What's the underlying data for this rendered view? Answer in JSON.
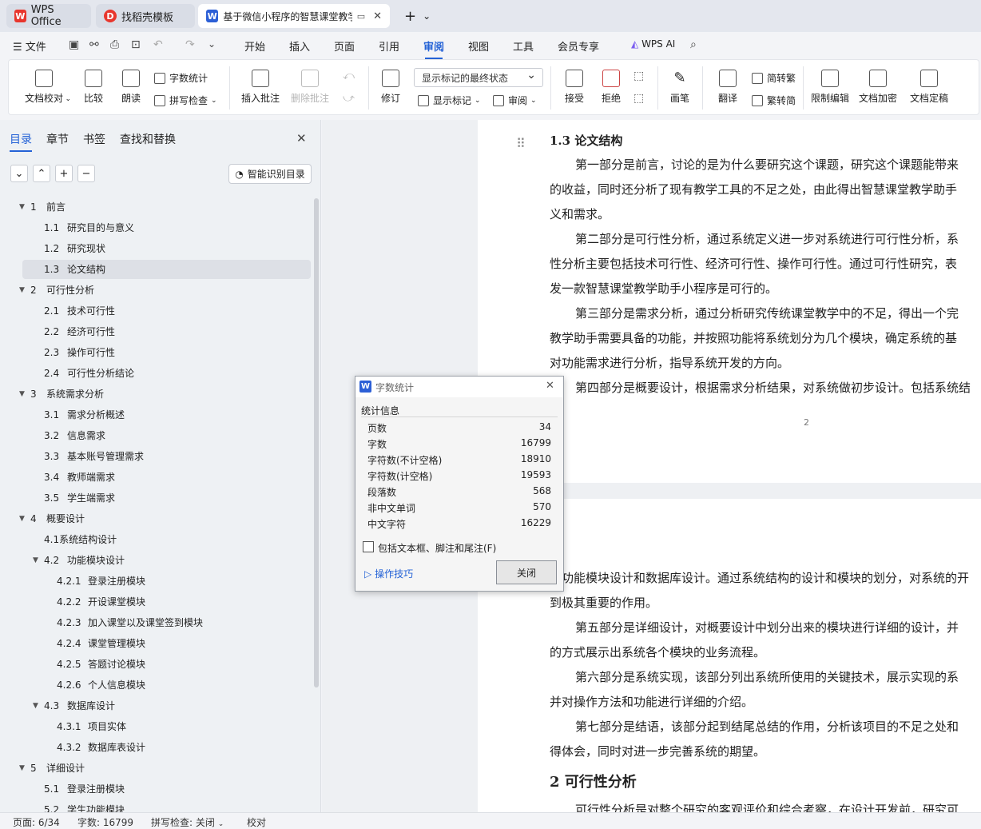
{
  "tabs": [
    {
      "label": "WPS Office",
      "icon": "wps-logo-icon"
    },
    {
      "label": "找稻壳模板",
      "icon": "daoke-logo-icon"
    },
    {
      "label": "基于微信小程序的智慧课堂教学",
      "icon": "word-doc-icon"
    }
  ],
  "menu": {
    "file": "文件",
    "items": [
      "开始",
      "插入",
      "页面",
      "引用",
      "审阅",
      "视图",
      "工具",
      "会员专享"
    ],
    "active": "审阅",
    "ai": "WPS AI"
  },
  "ribbon": {
    "proofread": "文档校对",
    "compare": "比较",
    "read_aloud": "朗读",
    "word_count": "字数统计",
    "spell_check": "拼写检查",
    "insert_comment": "插入批注",
    "delete_comment": "删除批注",
    "revise": "修订",
    "markup_state": "显示标记的最终状态",
    "show_markup": "显示标记",
    "review": "审阅",
    "accept": "接受",
    "reject": "拒绝",
    "pen": "画笔",
    "translate": "翻译",
    "to_trad": "简转繁",
    "to_simp": "繁转简",
    "restrict": "限制编辑",
    "encrypt": "文档加密",
    "finalize": "文档定稿"
  },
  "sidebar": {
    "tabs": [
      "目录",
      "章节",
      "书签",
      "查找和替换"
    ],
    "smart_button": "智能识别目录",
    "toc": [
      {
        "num": "1",
        "text": "前言",
        "level": 1,
        "arrow": true
      },
      {
        "num": "1.1",
        "text": "研究目的与意义",
        "level": 2
      },
      {
        "num": "1.2",
        "text": "研究现状",
        "level": 2
      },
      {
        "num": "1.3",
        "text": "论文结构",
        "level": 2,
        "selected": true
      },
      {
        "num": "2",
        "text": "可行性分析",
        "level": 1,
        "arrow": true
      },
      {
        "num": "2.1",
        "text": "技术可行性",
        "level": 2
      },
      {
        "num": "2.2",
        "text": "经济可行性",
        "level": 2
      },
      {
        "num": "2.3",
        "text": "操作可行性",
        "level": 2
      },
      {
        "num": "2.4",
        "text": "可行性分析结论",
        "level": 2
      },
      {
        "num": "3",
        "text": "系统需求分析",
        "level": 1,
        "arrow": true
      },
      {
        "num": "3.1",
        "text": "需求分析概述",
        "level": 2
      },
      {
        "num": "3.2",
        "text": "信息需求",
        "level": 2
      },
      {
        "num": "3.3",
        "text": "基本账号管理需求",
        "level": 2
      },
      {
        "num": "3.4",
        "text": "教师端需求",
        "level": 2
      },
      {
        "num": "3.5",
        "text": "学生端需求",
        "level": 2
      },
      {
        "num": "4",
        "text": "概要设计",
        "level": 1,
        "arrow": true
      },
      {
        "num": "",
        "text": "4.1系统结构设计",
        "level": 2
      },
      {
        "num": "4.2",
        "text": "功能模块设计",
        "level": 2,
        "arrow": true
      },
      {
        "num": "4.2.1",
        "text": "登录注册模块",
        "level": 3
      },
      {
        "num": "4.2.2",
        "text": "开设课堂模块",
        "level": 3
      },
      {
        "num": "4.2.3",
        "text": "加入课堂以及课堂签到模块",
        "level": 3
      },
      {
        "num": "4.2.4",
        "text": "课堂管理模块",
        "level": 3
      },
      {
        "num": "4.2.5",
        "text": "答题讨论模块",
        "level": 3
      },
      {
        "num": "4.2.6",
        "text": "个人信息模块",
        "level": 3
      },
      {
        "num": "4.3",
        "text": "数据库设计",
        "level": 2,
        "arrow": true
      },
      {
        "num": "4.3.1",
        "text": "项目实体",
        "level": 3
      },
      {
        "num": "4.3.2",
        "text": "数据库表设计",
        "level": 3
      },
      {
        "num": "5",
        "text": "详细设计",
        "level": 1,
        "arrow": true
      },
      {
        "num": "5.1",
        "text": "登录注册模块",
        "level": 2
      },
      {
        "num": "5.2",
        "text": "学生功能模块",
        "level": 2
      }
    ]
  },
  "document": {
    "page1": {
      "heading": "1.3   论文结构",
      "lines": [
        "第一部分是前言，讨论的是为什么要研究这个课题，研究这个课题能带来",
        "的收益，同时还分析了现有教学工具的不足之处，由此得出智慧课堂教学助手",
        "义和需求。",
        "第二部分是可行性分析，通过系统定义进一步对系统进行可行性分析，系",
        "性分析主要包括技术可行性、经济可行性、操作可行性。通过可行性研究，表",
        "发一款智慧课堂教学助手小程序是可行的。",
        "第三部分是需求分析，通过分析研究传统课堂教学中的不足，得出一个完",
        "教学助手需要具备的功能，并按照功能将系统划分为几个模块，确定系统的基",
        "对功能需求进行分析，指导系统开发的方向。",
        "第四部分是概要设计，根据需求分析结果，对系统做初步设计。包括系统结"
      ],
      "page_number": "2"
    },
    "page2": {
      "lines": [
        "功能模块设计和数据库设计。通过系统结构的设计和模块的划分，对系统的开",
        "到极其重要的作用。",
        "第五部分是详细设计，对概要设计中划分出来的模块进行详细的设计，并",
        "的方式展示出系统各个模块的业务流程。",
        "第六部分是系统实现，该部分列出系统所使用的关键技术，展示实现的系",
        "并对操作方法和功能进行详细的介绍。",
        "第七部分是结语，该部分起到结尾总结的作用，分析该项目的不足之处和",
        "得体会，同时对进一步完善系统的期望。"
      ],
      "heading": "2   可行性分析",
      "last_line": "可行性分析是对整个研究的客观评价和综合考察，在设计开发前，研究可"
    }
  },
  "dialog": {
    "title": "字数统计",
    "section": "统计信息",
    "stats": [
      {
        "label": "页数",
        "value": "34"
      },
      {
        "label": "字数",
        "value": "16799"
      },
      {
        "label": "字符数(不计空格)",
        "value": "18910"
      },
      {
        "label": "字符数(计空格)",
        "value": "19593"
      },
      {
        "label": "段落数",
        "value": "568"
      },
      {
        "label": "非中文单词",
        "value": "570"
      },
      {
        "label": "中文字符",
        "value": "16229"
      }
    ],
    "checkbox_label": "包括文本框、脚注和尾注(F)",
    "tips": "操作技巧",
    "close": "关闭"
  },
  "status": {
    "page": "页面: 6/34",
    "words": "字数: 16799",
    "spell": "拼写检查: 关闭",
    "proof": "校对"
  },
  "colors": {
    "accent": "#2462d6",
    "wps_red": "#e8362d",
    "word_blue": "#2c5fd6"
  }
}
